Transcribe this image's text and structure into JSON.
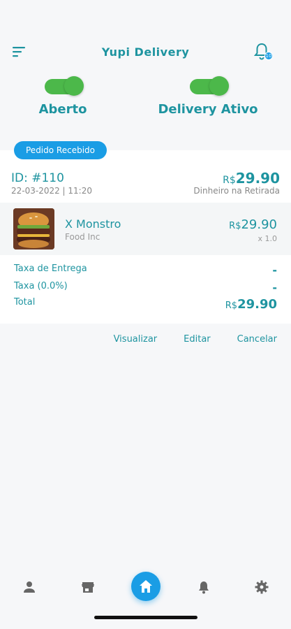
{
  "header": {
    "title": "Yupi Delivery",
    "notification_count": "10"
  },
  "toggles": [
    {
      "label": "Aberto",
      "on": true
    },
    {
      "label": "Delivery Ativo",
      "on": true
    }
  ],
  "order": {
    "status": "Pedido Recebido",
    "id": "ID: #110",
    "date": "22-03-2022 | 11:20",
    "currency": "R$",
    "total": "29.90",
    "payment": "Dinheiro na Retirada",
    "item": {
      "name": "X Monstro",
      "vendor": "Food Inc",
      "price": "29.90",
      "qty": "x 1.0"
    },
    "summary": {
      "delivery_fee_label": "Taxa de Entrega",
      "delivery_fee_value": "-",
      "tax_label": "Taxa (0.0%)",
      "tax_value": "-",
      "total_label": "Total",
      "total_value": "29.90"
    }
  },
  "actions": {
    "view": "Visualizar",
    "edit": "Editar",
    "cancel": "Cancelar"
  },
  "nav": {
    "items": [
      "profile-icon",
      "store-icon",
      "home-icon",
      "bell-icon",
      "settings-icon"
    ],
    "active": "home-icon"
  },
  "colors": {
    "accent": "#1e94a0",
    "primary_blue": "#1a9de5",
    "toggle_green": "#4cb84a"
  }
}
